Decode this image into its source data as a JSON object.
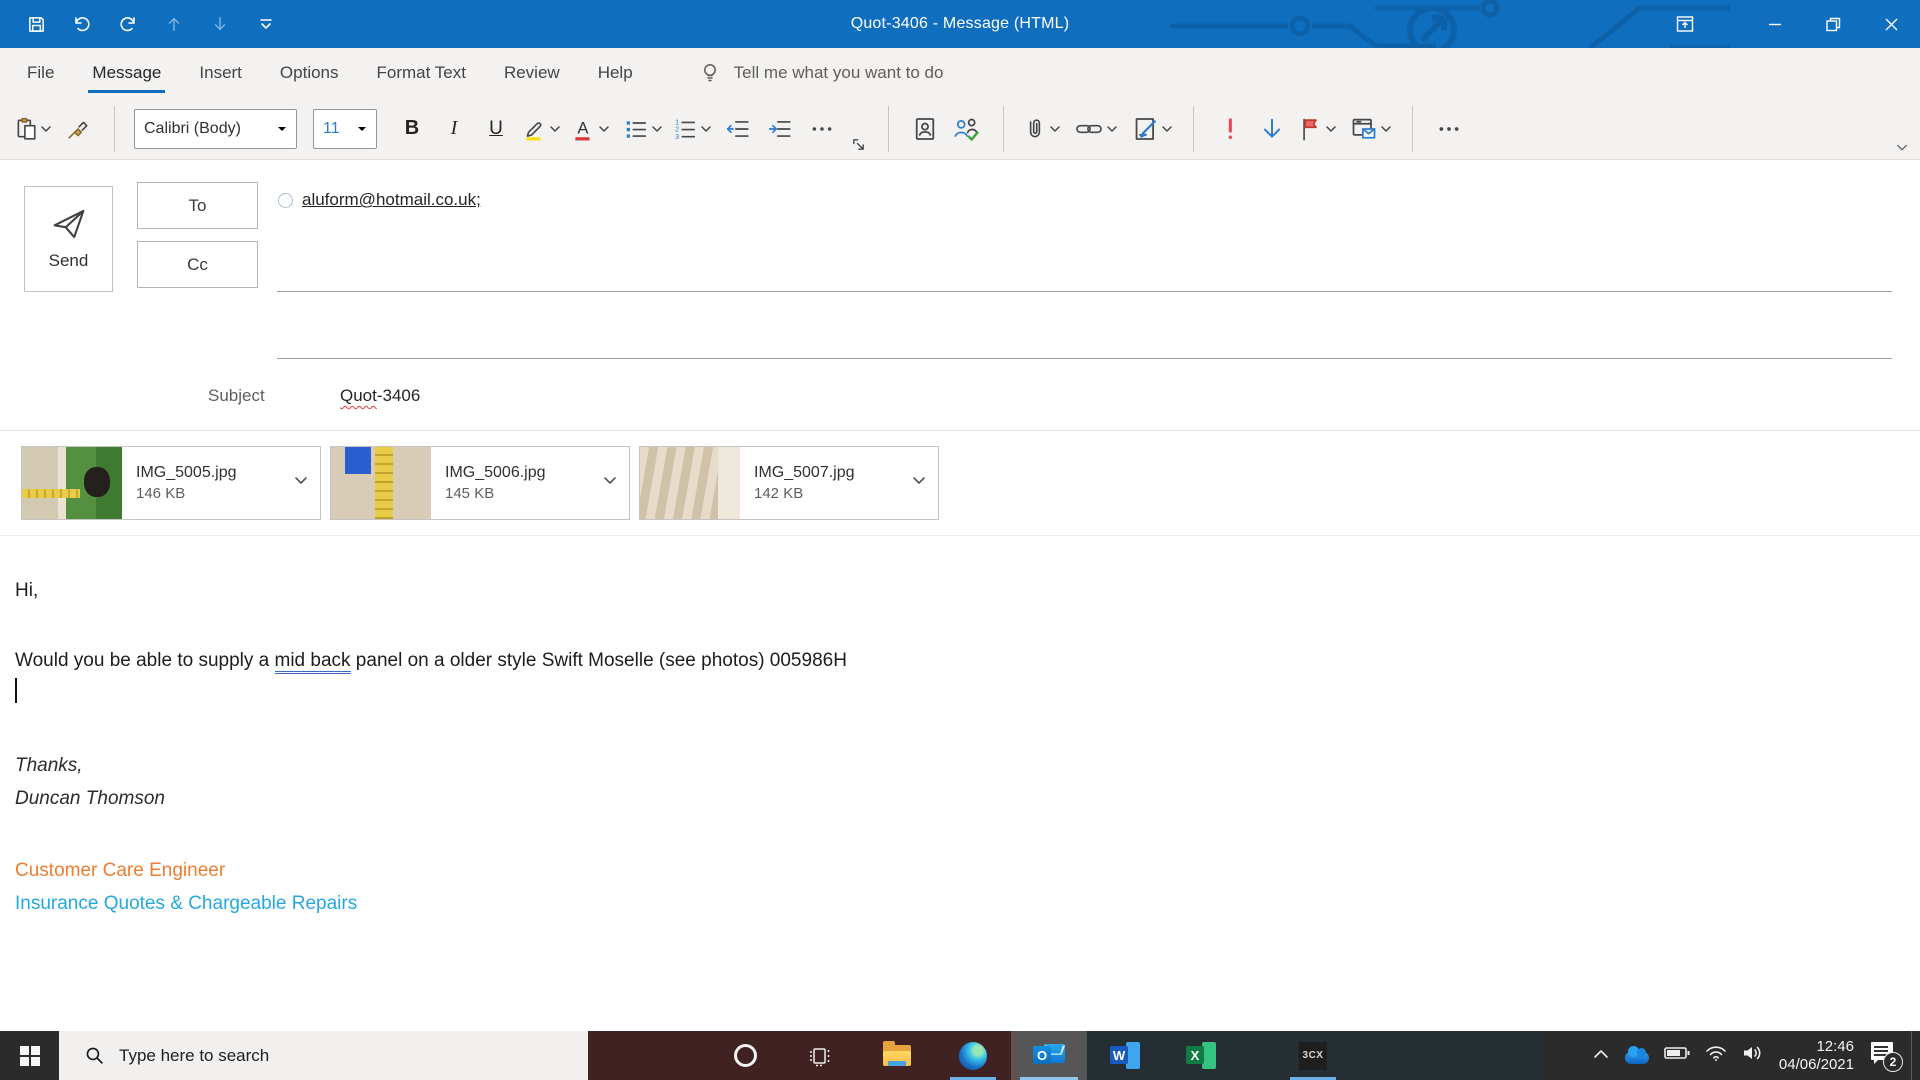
{
  "window": {
    "title": "Quot-3406  -  Message (HTML)"
  },
  "icons": {
    "quick_access": [
      "save-icon",
      "undo-icon",
      "redo-icon",
      "previous-item-icon",
      "next-item-icon",
      "customize-qat-icon"
    ],
    "window_controls": [
      "ribbon-display-options-icon",
      "minimize-icon",
      "restore-icon",
      "close-icon"
    ],
    "toolbar": [
      "paste-icon",
      "format-painter-icon",
      "bold",
      "italic",
      "underline",
      "highlight-icon",
      "font-color-icon",
      "bullets-icon",
      "numbering-icon",
      "decrease-indent-icon",
      "increase-indent-icon",
      "more-dots-icon",
      "dialog-launcher-icon",
      "address-book-icon",
      "check-names-icon",
      "attach-file-icon",
      "link-icon",
      "signature-icon",
      "high-importance-icon",
      "low-importance-icon",
      "follow-up-flag-icon",
      "view-templates-icon",
      "overflow-icon",
      "collapse-ribbon-icon"
    ],
    "tray": [
      "tray-chevron-icon",
      "onedrive-cloud-icon",
      "battery-icon",
      "wifi-icon",
      "volume-icon",
      "action-center-icon"
    ]
  },
  "ribbon": {
    "tabs": [
      {
        "label": "File"
      },
      {
        "label": "Message"
      },
      {
        "label": "Insert"
      },
      {
        "label": "Options"
      },
      {
        "label": "Format Text"
      },
      {
        "label": "Review"
      },
      {
        "label": "Help"
      }
    ],
    "selected_tab": "Message",
    "tell_me": "Tell me what you want to do",
    "font_name": "Calibri (Body)",
    "font_size": "11"
  },
  "compose": {
    "send_label": "Send",
    "to_label": "To",
    "cc_label": "Cc",
    "subject_label": "Subject",
    "to_value": "aluform@hotmail.co.uk;",
    "subject_misspelled": "Quot",
    "subject_rest": "-3406"
  },
  "attachments": [
    {
      "name": "IMG_5005.jpg",
      "size": "146 KB"
    },
    {
      "name": "IMG_5006.jpg",
      "size": "145 KB"
    },
    {
      "name": "IMG_5007.jpg",
      "size": "142 KB"
    }
  ],
  "body": {
    "greeting": "Hi,",
    "question_pre": "Would you be able to supply a ",
    "question_marked": "mid back",
    "question_post": " panel on a older style Swift Moselle (see photos) 005986H",
    "thanks": "Thanks,",
    "sender": "Duncan Thomson",
    "role": "Customer Care Engineer",
    "team": "Insurance Quotes & Chargeable Repairs"
  },
  "taskbar": {
    "search_placeholder": "Type here to search",
    "clock_time": "12:46",
    "clock_date": "04/06/2021",
    "notification_count": "2",
    "app_3cx_label": "3CX",
    "outlook_letter": "O",
    "word_letter": "W",
    "excel_letter": "X"
  },
  "colors": {
    "titlebar": "#106ebe",
    "tab_accent": "#106ebe",
    "font_size_value": "#2b7cd3",
    "role_orange": "#ED7D31",
    "team_blue": "#25A8E0",
    "importance_red": "#E84855",
    "highlight_yellow": "#F5E11A",
    "fontcolor_red": "#D83B3B",
    "grammar_blue": "#3B6BC4",
    "spell_red": "#E03C3C"
  }
}
